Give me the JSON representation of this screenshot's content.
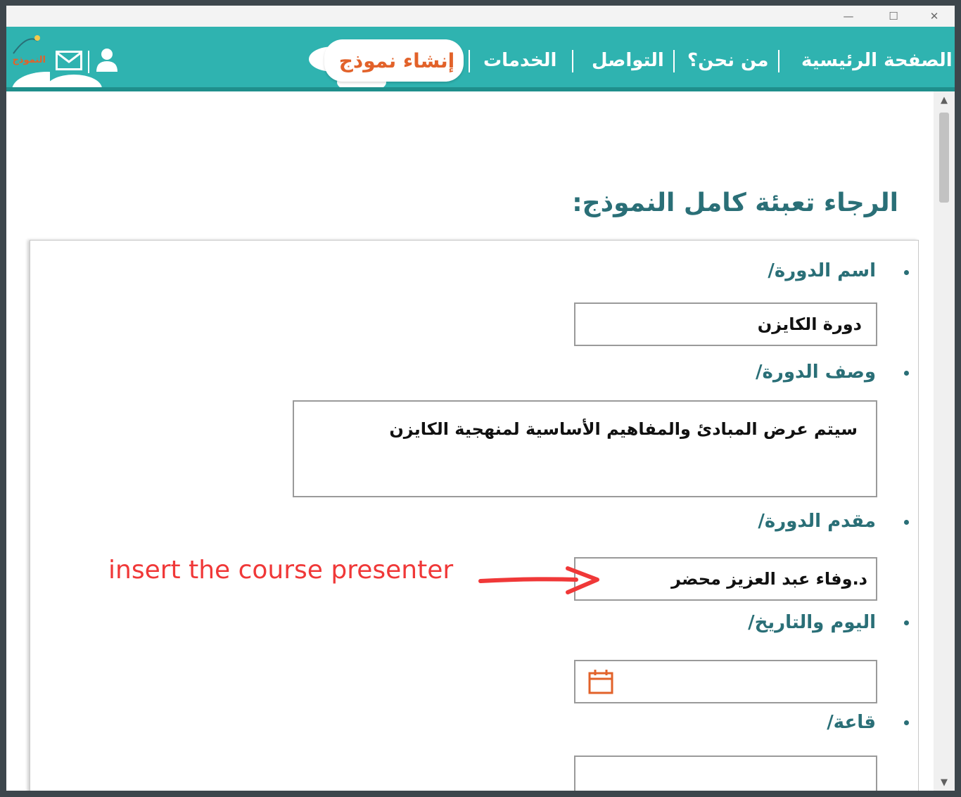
{
  "window": {
    "minimize_glyph": "—",
    "maximize_glyph": "☐",
    "close_glyph": "✕"
  },
  "nav": {
    "items": [
      {
        "label": "الصفحة الرئيسية"
      },
      {
        "label": "من نحن؟"
      },
      {
        "label": "التواصل"
      },
      {
        "label": "الخدمات"
      }
    ],
    "create_form_label": "إنشاء نموذج",
    "logo_text": "النموذج",
    "icons": [
      "user-icon",
      "mail-icon",
      "logo-icon"
    ]
  },
  "page": {
    "heading": "الرجاء تعبئة كامل النموذج:"
  },
  "form": {
    "fields": [
      {
        "label": "اسم الدورة/",
        "value": "دورة الكايزن"
      },
      {
        "label": "وصف الدورة/",
        "value": "سيتم عرض المبادئ والمفاهيم الأساسية لمنهجية الكايزن"
      },
      {
        "label": "مقدم الدورة/",
        "value": "د.وفاء عبد العزيز محضر"
      },
      {
        "label": "اليوم والتاريخ/",
        "value": "",
        "icon": "calendar-icon"
      },
      {
        "label": "قاعة/",
        "value": ""
      }
    ]
  },
  "annotation": {
    "text": "insert the course presenter",
    "color": "#f03838"
  },
  "colors": {
    "navbar": "#2fb3b0",
    "accent_orange": "#e2622a",
    "heading_teal": "#2a6f77"
  }
}
